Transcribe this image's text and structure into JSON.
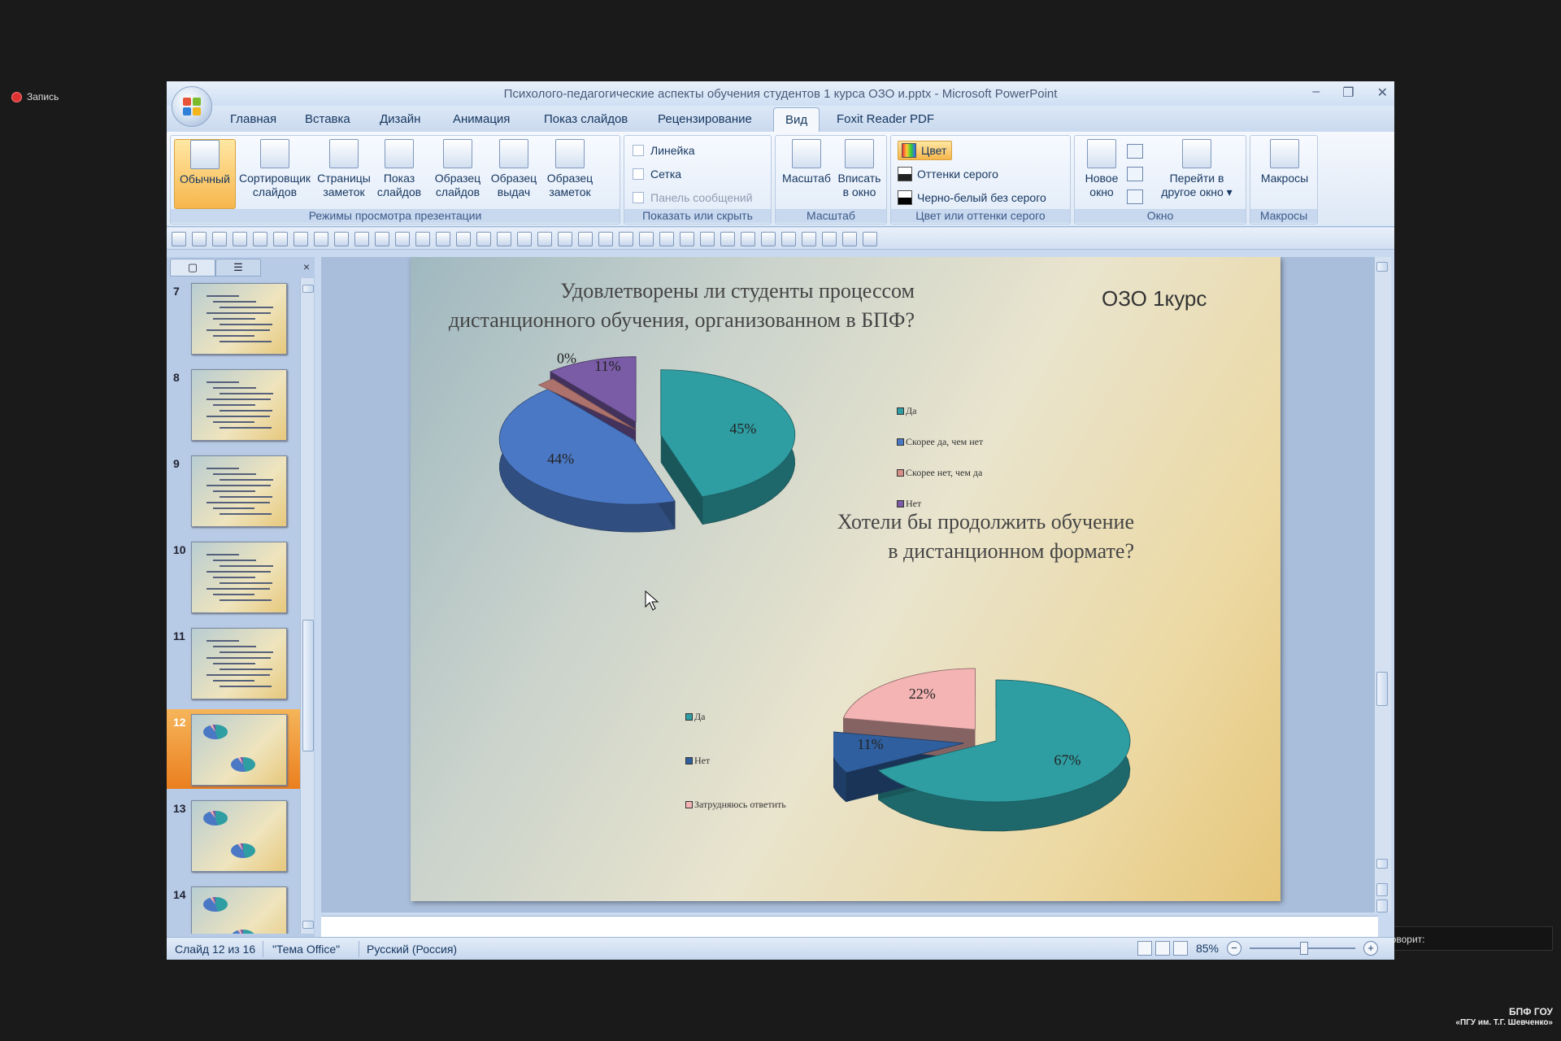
{
  "overlay": {
    "recording_label": "Запись",
    "speaking_label": "Говорит:",
    "watermark_line1": "БПФ ГОУ",
    "watermark_line2": "«ПГУ им. Т.Г. Шевченко»"
  },
  "window": {
    "title": "Психолого-педагогические аспекты обучения студентов 1 курса ОЗО и.pptx - Microsoft PowerPoint",
    "controls": {
      "minimize": "–",
      "maximize": "❐",
      "close": "✕"
    }
  },
  "ribbon": {
    "tabs": [
      "Главная",
      "Вставка",
      "Дизайн",
      "Анимация",
      "Показ слайдов",
      "Рецензирование",
      "Вид",
      "Foxit Reader PDF"
    ],
    "active_tab": "Вид",
    "groups": {
      "views": {
        "label": "Режимы просмотра презентации",
        "buttons": [
          "Обычный",
          "Сортировщик слайдов",
          "Страницы заметок",
          "Показ слайдов",
          "Образец слайдов",
          "Образец выдач",
          "Образец заметок"
        ]
      },
      "show_hide": {
        "label": "Показать или скрыть",
        "items": [
          "Линейка",
          "Сетка",
          "Панель сообщений"
        ]
      },
      "zoom": {
        "label": "Масштаб",
        "buttons": [
          "Масштаб",
          "Вписать в окно"
        ]
      },
      "color": {
        "label": "Цвет или оттенки серого",
        "items": [
          "Цвет",
          "Оттенки серого",
          "Черно-белый без серого"
        ]
      },
      "window": {
        "label": "Окно",
        "buttons": [
          "Новое окно",
          "Перейти в другое окно"
        ]
      },
      "macros": {
        "label": "Макросы",
        "buttons": [
          "Макросы"
        ]
      }
    }
  },
  "slides_panel": {
    "tab_slides": "▢",
    "tab_outline": "☰",
    "close": "×",
    "thumbnails": [
      "7",
      "8",
      "9",
      "10",
      "11",
      "12",
      "13",
      "14"
    ],
    "selected": "12"
  },
  "slide": {
    "title1": "Удовлетворены ли студенты процессом дистанционного обучения, организованном в БПФ?",
    "tag": "ОЗО  1курс",
    "title2_line1": "Хотели бы продолжить обучение",
    "title2_line2": "в дистанционном формате?"
  },
  "chart_data": [
    {
      "type": "pie",
      "title": "Удовлетворены ли студенты процессом дистанционного обучения, организованном в БПФ?",
      "categories": [
        "Да",
        "Скорее да, чем нет",
        "Скорее нет, чем да",
        "Нет"
      ],
      "values": [
        45,
        44,
        0,
        11
      ],
      "labels": [
        "45%",
        "44%",
        "0%",
        "11%"
      ],
      "colors": [
        "#2e9ea3",
        "#4a78c4",
        "#d88e87",
        "#7a5ba6"
      ],
      "legend_position": "right"
    },
    {
      "type": "pie",
      "title": "Хотели бы продолжить обучение в дистанционном формате?",
      "categories": [
        "Да",
        "Нет",
        "Затрудняюсь ответить"
      ],
      "values": [
        67,
        11,
        22
      ],
      "labels": [
        "67%",
        "11%",
        "22%"
      ],
      "colors": [
        "#2e9ea3",
        "#2f5f9e",
        "#f4b4b4"
      ],
      "legend_position": "left"
    }
  ],
  "status": {
    "slide_info": "Слайд 12 из 16",
    "theme": "\"Тема Office\"",
    "language": "Русский (Россия)",
    "zoom": "85%",
    "zoom_out": "−",
    "zoom_in": "+"
  }
}
